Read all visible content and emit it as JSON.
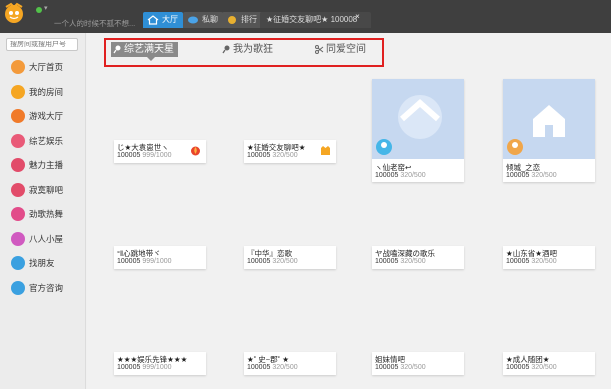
{
  "header": {
    "signature": "一个人的时候不孤不想...",
    "tabs": [
      {
        "label": "大厅",
        "icon": "home-icon"
      },
      {
        "label": "私聊",
        "icon": "chat-bubble-icon"
      },
      {
        "label": "排行",
        "icon": "rank-medal-icon"
      }
    ],
    "room_tab": {
      "label": "★征婚交友聊吧★ 100008",
      "close": "×"
    }
  },
  "sidebar": {
    "search_placeholder": "搜房间或搜用户号",
    "items": [
      {
        "label": "大厅首页",
        "icon": "home-icon",
        "color": "#f39a3b"
      },
      {
        "label": "我的房间",
        "icon": "star-icon",
        "color": "#f5a623"
      },
      {
        "label": "游戏大厅",
        "icon": "game-icon",
        "color": "#f07a2a"
      },
      {
        "label": "综艺娱乐",
        "icon": "music-icon",
        "color": "#e95a78"
      },
      {
        "label": "魅力主播",
        "icon": "anchor-icon",
        "color": "#e24c6a"
      },
      {
        "label": "寂寞聊吧",
        "icon": "chat-icon",
        "color": "#e24c6a"
      },
      {
        "label": "劲歌热舞",
        "icon": "dance-icon",
        "color": "#e24c8a"
      },
      {
        "label": "八人小屋",
        "icon": "people-icon",
        "color": "#d05ac0"
      },
      {
        "label": "找朋友",
        "icon": "friends-icon",
        "color": "#3aa0e0"
      },
      {
        "label": "官方咨询",
        "icon": "info-icon",
        "color": "#3aa0e0"
      }
    ]
  },
  "categories": {
    "tabs": [
      {
        "label": "综艺满天星",
        "icon": "mic-icon"
      },
      {
        "label": "我为歌狂",
        "icon": "mic-icon"
      },
      {
        "label": "同爱空间",
        "icon": "scissors-icon"
      }
    ]
  },
  "rooms": [
    {
      "title": "じ★大袁崽世ヽ",
      "id": "100005",
      "occupancy": "999/1000",
      "badge": "fire-badge-icon"
    },
    {
      "title": "★征婚交友聊吧★",
      "id": "100005",
      "occupancy": "320/500",
      "badge": "crown-badge-icon"
    },
    {
      "title": "ヽ仙老窑↩",
      "id": "100005",
      "occupancy": "320/500",
      "badge": "lock-badge-icon"
    },
    {
      "title": "倾城_之恋",
      "id": "100005",
      "occupancy": "320/500",
      "badge": "lock-badge-icon"
    },
    {
      "title": "°‖心跳地带ヾ",
      "id": "100005",
      "occupancy": "999/1000",
      "badge": ""
    },
    {
      "title": "『中华』恋歌",
      "id": "100005",
      "occupancy": "320/500",
      "badge": ""
    },
    {
      "title": "ヤ战嗑深藏の歌乐",
      "id": "100005",
      "occupancy": "320/500",
      "badge": ""
    },
    {
      "title": "★山东省★酒吧",
      "id": "100005",
      "occupancy": "320/500",
      "badge": ""
    },
    {
      "title": "★★★娱乐先锋★★★",
      "id": "100005",
      "occupancy": "999/1000",
      "badge": ""
    },
    {
      "title": "★˚ 史~郡˚ ★",
      "id": "100005",
      "occupancy": "320/500",
      "badge": ""
    },
    {
      "title": "姐妹情吧",
      "id": "100005",
      "occupancy": "320/500",
      "badge": ""
    },
    {
      "title": "★成人随团★",
      "id": "100005",
      "occupancy": "320/500",
      "badge": ""
    }
  ]
}
